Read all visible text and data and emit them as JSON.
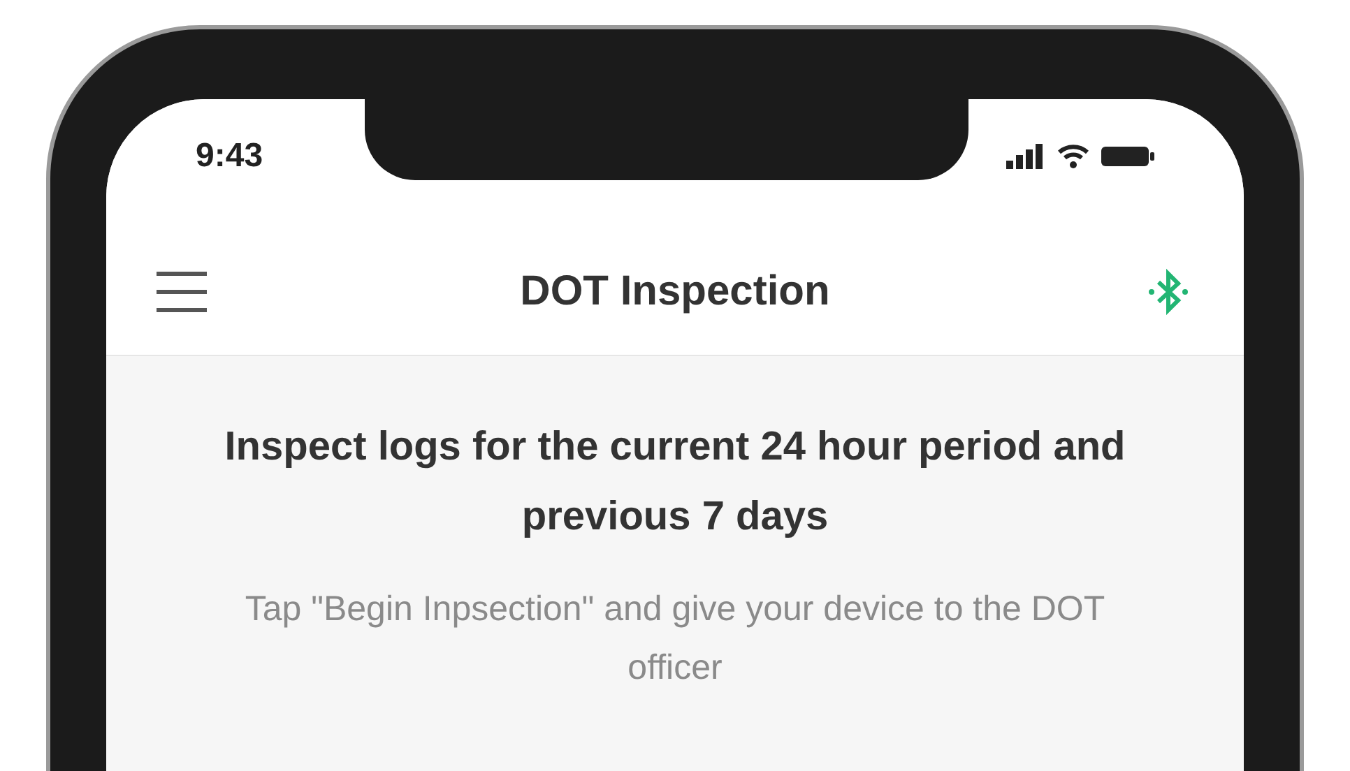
{
  "status_bar": {
    "time": "9:43"
  },
  "header": {
    "title": "DOT Inspection",
    "bluetooth_connected": true
  },
  "content": {
    "heading": "Inspect logs for the current 24 hour period and previous 7 days",
    "instruction": "Tap \"Begin Inpsection\" and give your device to the DOT officer"
  }
}
